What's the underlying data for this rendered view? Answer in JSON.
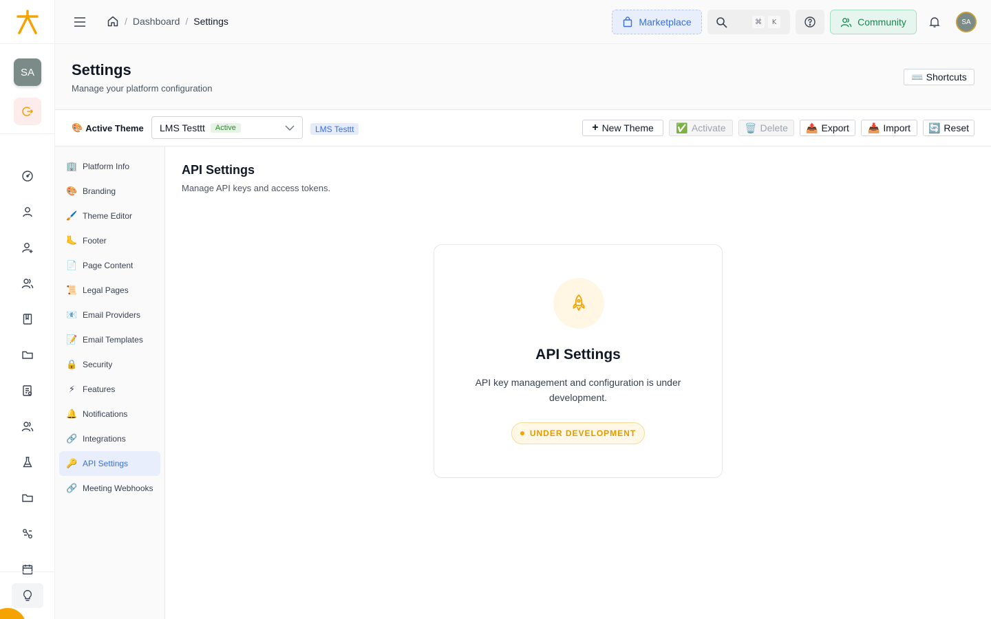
{
  "topbar": {
    "breadcrumb": {
      "item1": "Dashboard",
      "current": "Settings",
      "sep": "/"
    },
    "marketplace_label": "Marketplace",
    "search_kbd_cmd": "⌘",
    "search_kbd_key": "K",
    "community_label": "Community",
    "user_initials": "SA"
  },
  "rail": {
    "user_initials": "SA",
    "nav_icons": [
      "dashboard-icon",
      "user-icon",
      "user-add-icon",
      "users-icon",
      "book-icon",
      "folder-icon",
      "report-icon",
      "team-icon",
      "lab-icon",
      "folder-icon",
      "workflow-icon",
      "calendar-icon"
    ]
  },
  "page": {
    "title": "Settings",
    "subtitle": "Manage your platform configuration",
    "shortcuts_label": "Shortcuts",
    "shortcuts_icon": "⌨️"
  },
  "theme_bar": {
    "label": "Active Theme",
    "label_icon": "🎨",
    "selected_theme": "LMS Testtt",
    "selected_badge": "Active",
    "theme_tag": "LMS Testtt",
    "buttons": {
      "new_theme": "New Theme",
      "activate": "Activate",
      "delete": "Delete",
      "export": "Export",
      "import": "Import",
      "reset": "Reset"
    },
    "button_icons": {
      "new_theme": "➕",
      "activate": "✅",
      "delete": "🗑️",
      "export": "📤",
      "import": "📥",
      "reset": "🔄"
    }
  },
  "settings_nav": {
    "items": [
      {
        "label": "Platform Info",
        "icon": "🏢"
      },
      {
        "label": "Branding",
        "icon": "🎨"
      },
      {
        "label": "Theme Editor",
        "icon": "🖌️"
      },
      {
        "label": "Footer",
        "icon": "🦶"
      },
      {
        "label": "Page Content",
        "icon": "📄"
      },
      {
        "label": "Legal Pages",
        "icon": "📜"
      },
      {
        "label": "Email Providers",
        "icon": "📧"
      },
      {
        "label": "Email Templates",
        "icon": "📝"
      },
      {
        "label": "Security",
        "icon": "🔒"
      },
      {
        "label": "Features",
        "icon": "⚡"
      },
      {
        "label": "Notifications",
        "icon": "🔔"
      },
      {
        "label": "Integrations",
        "icon": "🔗"
      },
      {
        "label": "API Settings",
        "icon": "🔑"
      },
      {
        "label": "Meeting Webhooks",
        "icon": "🔗"
      }
    ],
    "active_index": 12
  },
  "content": {
    "title": "API Settings",
    "subtitle": "Manage API keys and access tokens.",
    "card": {
      "title": "API Settings",
      "description": "API key management and configuration is under development.",
      "badge": "UNDER DEVELOPMENT",
      "icon": "rocket-icon"
    }
  },
  "colors": {
    "brand_orange": "#f5a300",
    "accent_blue": "#3b6fe0",
    "community_green": "#15894f"
  }
}
